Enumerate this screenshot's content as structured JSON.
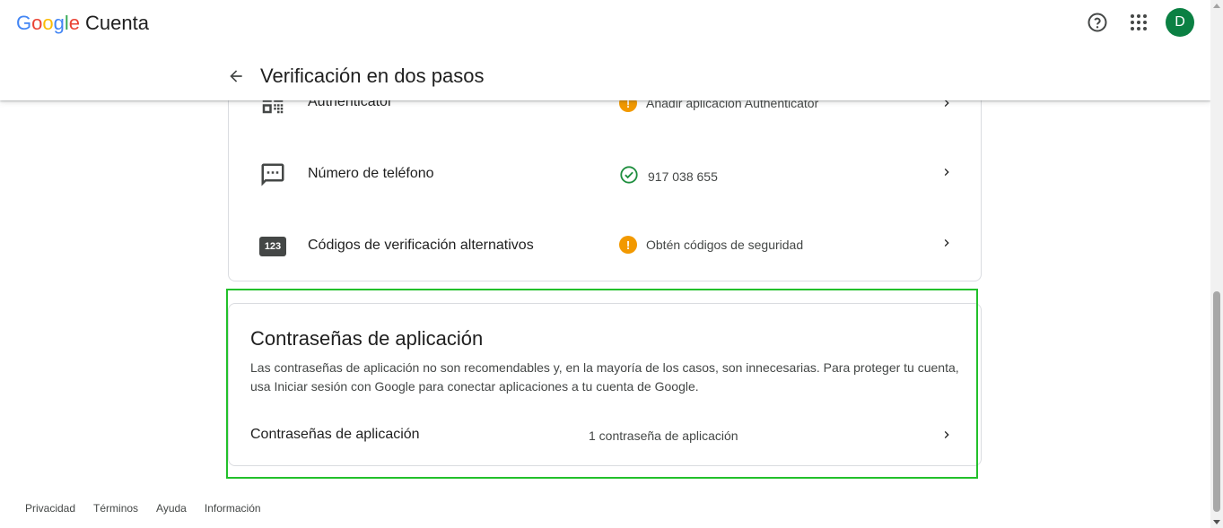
{
  "header": {
    "logo_letters": [
      "G",
      "o",
      "o",
      "g",
      "l",
      "e"
    ],
    "logo_colors": [
      "#4285f4",
      "#ea4335",
      "#fbbc05",
      "#4285f4",
      "#34a853",
      "#ea4335"
    ],
    "product": "Cuenta",
    "help_icon": "help-circle-icon",
    "apps_icon": "apps-grid-icon",
    "avatar_letter": "D",
    "avatar_color": "#0b8043",
    "page_title": "Verificación en dos pasos"
  },
  "methods": [
    {
      "label": "Authenticator",
      "status": "Añadir aplicación Authenticator",
      "status_icon": "warning-icon",
      "icon": "qr-code-icon"
    },
    {
      "label": "Número de teléfono",
      "status": "917 038 655",
      "status_icon": "check-circle-icon",
      "icon": "sms-icon"
    },
    {
      "label": "Códigos de verificación alternativos",
      "status": "Obtén códigos de seguridad",
      "status_icon": "warning-icon",
      "icon": "backup-codes-icon",
      "icon_text": "123"
    }
  ],
  "app_passwords": {
    "title": "Contraseñas de aplicación",
    "description": "Las contraseñas de aplicación no son recomendables y, en la mayoría de los casos, son innecesarias. Para proteger tu cuenta, usa Iniciar sesión con Google para conectar aplicaciones a tu cuenta de Google.",
    "row_label": "Contraseñas de aplicación",
    "row_count": "1 contraseña de aplicación"
  },
  "footer": {
    "links": [
      "Privacidad",
      "Términos",
      "Ayuda",
      "Información"
    ]
  },
  "colors": {
    "warning": "#f29900",
    "success": "#1e8e3e",
    "highlight": "#22c02b"
  }
}
